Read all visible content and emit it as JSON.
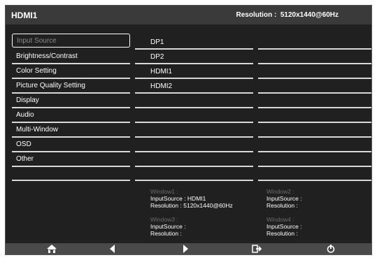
{
  "header": {
    "title": "HDMI1",
    "resolution": "Resolution :  5120x1440@60Hz"
  },
  "menu": {
    "items": [
      {
        "label": "Input Source",
        "selected": true
      },
      {
        "label": "Brightness/Contrast"
      },
      {
        "label": "Color Setting"
      },
      {
        "label": "Picture Quality Setting"
      },
      {
        "label": "Display"
      },
      {
        "label": "Audio"
      },
      {
        "label": "Multi-Window"
      },
      {
        "label": "OSD"
      },
      {
        "label": "Other"
      }
    ]
  },
  "submenu": {
    "items": [
      "DP1",
      "DP2",
      "HDMI1",
      "HDMI2"
    ]
  },
  "windows": {
    "w1": {
      "title": "Window1 :",
      "input": "InputSource :  HDMI1",
      "res": "Resolution :  5120x1440@60Hz"
    },
    "w2": {
      "title": "Window2 :",
      "input": "InputSource :",
      "res": "Resolution :"
    },
    "w3": {
      "title": "Window3 :",
      "input": "InputSource :",
      "res": "Resolution :"
    },
    "w4": {
      "title": "Window4 :",
      "input": "InputSource :",
      "res": "Resolution :"
    }
  },
  "footer": {
    "icons": [
      "home-icon",
      "left-arrow-icon",
      "right-arrow-icon",
      "exit-icon",
      "power-icon"
    ]
  },
  "colors": {
    "background": "#202020",
    "header": "#3a3a3a",
    "footer": "#4a4a4a",
    "text": "#ffffff",
    "dim_text": "#6c6c6c"
  }
}
